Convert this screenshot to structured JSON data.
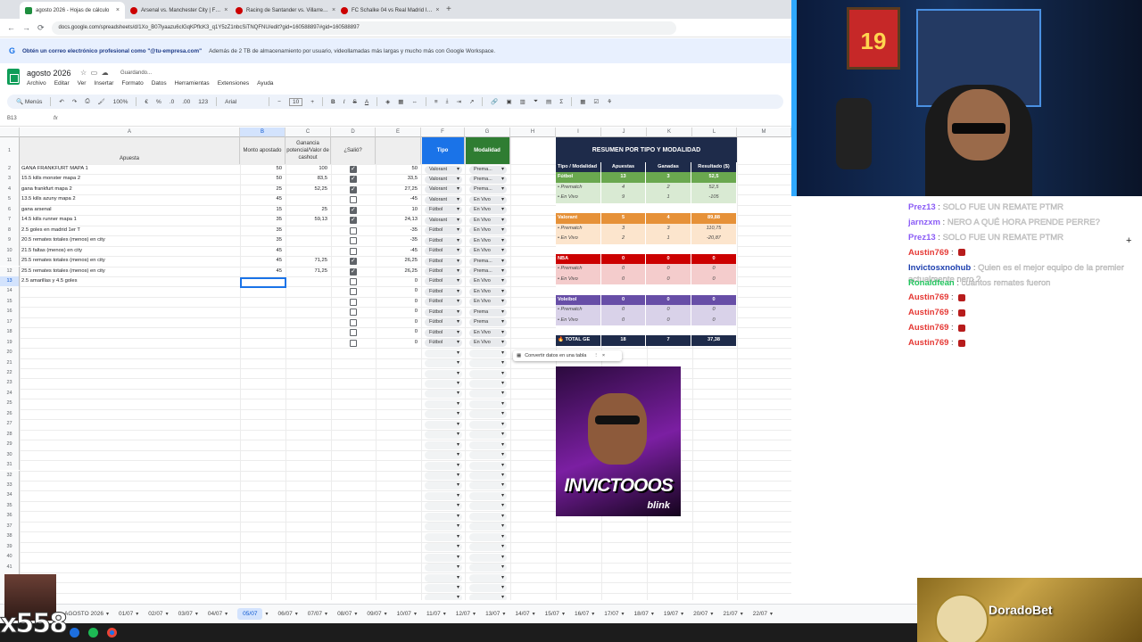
{
  "browser": {
    "tabs": [
      {
        "label": "agosto 2026 - Hojas de cálculo",
        "active": true
      },
      {
        "label": "Arsenal vs. Manchester City | F…"
      },
      {
        "label": "Racing de Santander vs. Villarre…"
      },
      {
        "label": "FC Schalke 04 vs Real Madrid I…"
      }
    ],
    "new_tab": "+",
    "url": "docs.google.com/spreadsheets/d/1Xo_B07lyaazu6clGqKPflcK3_q1Y5zZ1nbcSiTNQFNU/edit?gid=160588897#gid=160588897"
  },
  "promo": {
    "bold": "Obtén un correo electrónico profesional como \"@tu-empresa.com\"",
    "rest": "Además de 2 TB de almacenamiento por usuario, videollamadas más largas y mucho más con Google Workspace."
  },
  "doc": {
    "title": "agosto 2026",
    "saving": "Guardando...",
    "menu": [
      "Archivo",
      "Editar",
      "Ver",
      "Insertar",
      "Formato",
      "Datos",
      "Herramientas",
      "Extensiones",
      "Ayuda"
    ]
  },
  "toolbar": {
    "menus": "Menús",
    "zoom": "100%",
    "currency": "€",
    "percent": "%",
    "dec1": ".0",
    "dec2": ".00",
    "fmt": "123",
    "font": "Arial",
    "size": "10"
  },
  "formula": {
    "namebox": "B13",
    "fx": "fx"
  },
  "columns": [
    "A",
    "B",
    "C",
    "D",
    "E",
    "F",
    "G",
    "H",
    "I",
    "J",
    "K",
    "L",
    "M"
  ],
  "headers": {
    "apuesta": "Apuesta",
    "monto": "Monto apostado",
    "ganancia": "Ganancia potencial/Valor de cashout",
    "salio": "¿Salió?",
    "tipo": "Tipo",
    "modalidad": "Modalidad"
  },
  "rows": [
    {
      "n": "2",
      "a": "GANA FRANKFURT MAPA 1",
      "b": "50",
      "c": "100",
      "d": true,
      "e": "50",
      "f": "Valorant",
      "g": "Prema..."
    },
    {
      "n": "3",
      "a": "15.5 kills monster mapa 2",
      "b": "50",
      "c": "83,5",
      "d": true,
      "e": "33,5",
      "f": "Valorant",
      "g": "Prema..."
    },
    {
      "n": "4",
      "a": "gana frankfurt mapa 2",
      "b": "25",
      "c": "52,25",
      "d": true,
      "e": "27,25",
      "f": "Valorant",
      "g": "Prema..."
    },
    {
      "n": "5",
      "a": "13.5 kills azuny mapa 2",
      "b": "45",
      "c": "",
      "d": false,
      "e": "-45",
      "f": "Valorant",
      "g": "En Vivo"
    },
    {
      "n": "6",
      "a": "gana arsenal",
      "b": "15",
      "c": "25",
      "d": true,
      "e": "10",
      "f": "Fútbol",
      "g": "En Vivo"
    },
    {
      "n": "7",
      "a": "14.5 kills runner mapa 1",
      "b": "35",
      "c": "59,13",
      "d": true,
      "e": "24,13",
      "f": "Valorant",
      "g": "En Vivo"
    },
    {
      "n": "8",
      "a": "2.5 goles en madrid 1er T",
      "b": "35",
      "c": "",
      "d": false,
      "e": "-35",
      "f": "Fútbol",
      "g": "En Vivo"
    },
    {
      "n": "9",
      "a": "20.5 remates totales (menos) en city",
      "b": "35",
      "c": "",
      "d": false,
      "e": "-35",
      "f": "Fútbol",
      "g": "En Vivo"
    },
    {
      "n": "10",
      "a": "21.5 faltas (menos) en city",
      "b": "45",
      "c": "",
      "d": false,
      "e": "-45",
      "f": "Fútbol",
      "g": "En Vivo"
    },
    {
      "n": "11",
      "a": "25.5 remates totales (menos) en city",
      "b": "45",
      "c": "71,25",
      "d": true,
      "e": "26,25",
      "f": "Fútbol",
      "g": "Prema..."
    },
    {
      "n": "12",
      "a": "25.5 remates totales (menos) en city",
      "b": "45",
      "c": "71,25",
      "d": true,
      "e": "26,25",
      "f": "Fútbol",
      "g": "Prema..."
    },
    {
      "n": "13",
      "a": "2.5 amarillas y 4.5 goles",
      "b": "",
      "c": "",
      "d": false,
      "e": "0",
      "f": "Fútbol",
      "g": "En Vivo"
    },
    {
      "n": "14",
      "a": "",
      "b": "",
      "c": "",
      "d": false,
      "e": "0",
      "f": "Fútbol",
      "g": "En Vivo"
    },
    {
      "n": "15",
      "a": "",
      "b": "",
      "c": "",
      "d": false,
      "e": "0",
      "f": "Fútbol",
      "g": "En Vivo"
    },
    {
      "n": "16",
      "a": "",
      "b": "",
      "c": "",
      "d": false,
      "e": "0",
      "f": "Fútbol",
      "g": "Prema"
    },
    {
      "n": "17",
      "a": "",
      "b": "",
      "c": "",
      "d": false,
      "e": "0",
      "f": "Fútbol",
      "g": "Prema"
    },
    {
      "n": "18",
      "a": "",
      "b": "",
      "c": "",
      "d": false,
      "e": "0",
      "f": "Fútbol",
      "g": "En Vivo"
    },
    {
      "n": "19",
      "a": "",
      "b": "",
      "c": "",
      "d": false,
      "e": "0",
      "f": "Fútbol",
      "g": "En Vivo"
    }
  ],
  "summary": {
    "title": "RESUMEN POR TIPO Y MODALIDAD",
    "headers": [
      "Tipo / Modalidad",
      "Apuestas",
      "Ganadas",
      "Resultado ($)"
    ],
    "rows": [
      {
        "c": [
          "Fútbol",
          "13",
          "3",
          "52,5"
        ],
        "kind": "main",
        "bg": "#6aa84f"
      },
      {
        "c": [
          "• Prematch",
          "4",
          "2",
          "52,5"
        ],
        "kind": "sub",
        "bg": "#d9ead3"
      },
      {
        "c": [
          "• En Vivo",
          "9",
          "1",
          "-105"
        ],
        "kind": "sub",
        "bg": "#d9ead3"
      },
      {
        "c": [
          "",
          "",
          "",
          ""
        ],
        "kind": "blank",
        "bg": "#ffffff"
      },
      {
        "c": [
          "Valorant",
          "5",
          "4",
          "89,88"
        ],
        "kind": "main",
        "bg": "#e69138"
      },
      {
        "c": [
          "• Prematch",
          "3",
          "3",
          "110,75"
        ],
        "kind": "sub",
        "bg": "#fce5cd"
      },
      {
        "c": [
          "• En Vivo",
          "2",
          "1",
          "-20,87"
        ],
        "kind": "sub",
        "bg": "#fce5cd"
      },
      {
        "c": [
          "",
          "",
          "",
          ""
        ],
        "kind": "blank",
        "bg": "#ffffff"
      },
      {
        "c": [
          "NBA",
          "0",
          "0",
          "0"
        ],
        "kind": "main",
        "bg": "#cc0000"
      },
      {
        "c": [
          "• Prematch",
          "0",
          "0",
          "0"
        ],
        "kind": "sub",
        "bg": "#f4cccc"
      },
      {
        "c": [
          "• En Vivo",
          "0",
          "0",
          "0"
        ],
        "kind": "sub",
        "bg": "#f4cccc"
      },
      {
        "c": [
          "",
          "",
          "",
          ""
        ],
        "kind": "blank",
        "bg": "#ffffff"
      },
      {
        "c": [
          "Voleibol",
          "0",
          "0",
          "0"
        ],
        "kind": "main",
        "bg": "#674ea7"
      },
      {
        "c": [
          "• Prematch",
          "0",
          "0",
          "0"
        ],
        "kind": "sub",
        "bg": "#d9d2e9"
      },
      {
        "c": [
          "• En Vivo",
          "0",
          "0",
          "0"
        ],
        "kind": "sub",
        "bg": "#d9d2e9"
      },
      {
        "c": [
          "",
          "",
          "",
          ""
        ],
        "kind": "blank",
        "bg": "#ffffff"
      },
      {
        "c": [
          "🔥 TOTAL GE",
          "18",
          "7",
          "37,38"
        ],
        "kind": "total",
        "bg": "#1e2b4a"
      }
    ]
  },
  "convert_chip": "Convertir datos en una tabla",
  "thumbnail": {
    "text": "INVICTOOOS",
    "brand": "blink"
  },
  "sheet_tabs": [
    "AGOSTO 2026",
    "01/07",
    "02/07",
    "03/07",
    "04/07",
    "05/07",
    "06/07",
    "07/07",
    "08/07",
    "09/07",
    "10/07",
    "11/07",
    "12/07",
    "13/07",
    "14/07",
    "15/07",
    "16/07",
    "17/07",
    "18/07",
    "19/07",
    "20/07",
    "21/07",
    "22/07"
  ],
  "active_sheet": "05/07",
  "stream": {
    "jersey": "19",
    "chat": [
      {
        "user": "Prez13",
        "text": "SOLO FUE UN REMATE PTMR",
        "color": "#8b5cf6"
      },
      {
        "user": "jarnzxm",
        "text": "NERO A QUÉ HORA PRENDE PERRE?",
        "color": "#8b5cf6"
      },
      {
        "user": "Prez13",
        "text": "SOLO FUE UN REMATE PTMR",
        "color": "#8b5cf6"
      },
      {
        "user": "Austin769",
        "text": "",
        "color": "#e53935",
        "badge": true
      },
      {
        "user": "Invictosxnohub",
        "text": "Quien es el mejor equipo de la premier actualmente nero ?",
        "color": "#1e40af"
      },
      {
        "user": "Ronaldfean",
        "text": "cuántos remates fueron",
        "color": "#22c55e"
      },
      {
        "user": "Austin769",
        "text": "",
        "color": "#e53935",
        "badge": true
      },
      {
        "user": "Austin769",
        "text": "",
        "color": "#e53935",
        "badge": true
      },
      {
        "user": "Austin769",
        "text": "",
        "color": "#e53935",
        "badge": true
      },
      {
        "user": "Austin769",
        "text": "",
        "color": "#e53935",
        "badge": true
      }
    ],
    "sponsor": "DoradoBet",
    "counter": "x558"
  }
}
